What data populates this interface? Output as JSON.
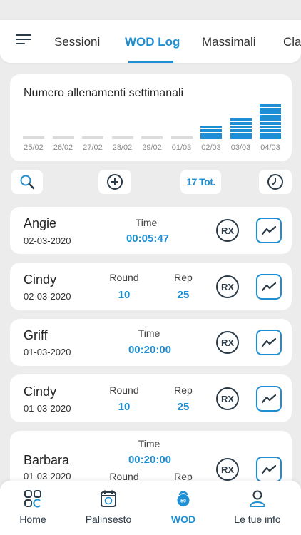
{
  "tabs": [
    {
      "label": "Sessioni"
    },
    {
      "label": "WOD Log"
    },
    {
      "label": "Massimali"
    },
    {
      "label": "Classifica"
    }
  ],
  "chart_data": {
    "type": "bar",
    "title": "Numero allenamenti settimanali",
    "categories": [
      "25/02",
      "26/02",
      "27/02",
      "28/02",
      "29/02",
      "01/03",
      "02/03",
      "03/03",
      "04/03"
    ],
    "values": [
      0,
      0,
      0,
      0,
      0,
      0,
      4,
      6,
      10
    ],
    "colors": {
      "bar": "#1e8fd4",
      "empty": "#dcdcdc"
    }
  },
  "toolbar": {
    "total_label": "17 Tot."
  },
  "wods": [
    {
      "name": "Angie",
      "date": "02-03-2020",
      "fields": [
        {
          "label": "Time",
          "value": "00:05:47"
        }
      ],
      "badge": "RX"
    },
    {
      "name": "Cindy",
      "date": "02-03-2020",
      "fields": [
        {
          "label": "Round",
          "value": "10"
        },
        {
          "label": "Rep",
          "value": "25"
        }
      ],
      "badge": "RX"
    },
    {
      "name": "Griff",
      "date": "01-03-2020",
      "fields": [
        {
          "label": "Time",
          "value": "00:20:00"
        }
      ],
      "badge": "RX"
    },
    {
      "name": "Cindy",
      "date": "01-03-2020",
      "fields": [
        {
          "label": "Round",
          "value": "10"
        },
        {
          "label": "Rep",
          "value": "25"
        }
      ],
      "badge": "RX"
    },
    {
      "name": "Barbara",
      "date": "01-03-2020",
      "fields": [
        {
          "label": "Time",
          "value": "00:20:00"
        },
        {
          "label": "Round",
          "value": ""
        },
        {
          "label": "Rep",
          "value": ""
        }
      ],
      "badge": "RX"
    }
  ],
  "bottom_nav": [
    {
      "label": "Home",
      "icon": "home-grid-icon"
    },
    {
      "label": "Palinsesto",
      "icon": "calendar-icon"
    },
    {
      "label": "WOD",
      "icon": "kettlebell-icon",
      "icon_text": "50"
    },
    {
      "label": "Le tue info",
      "icon": "user-icon"
    }
  ],
  "colors": {
    "accent": "#1e8fd4",
    "dark": "#2b3a47",
    "background": "#ececec"
  }
}
